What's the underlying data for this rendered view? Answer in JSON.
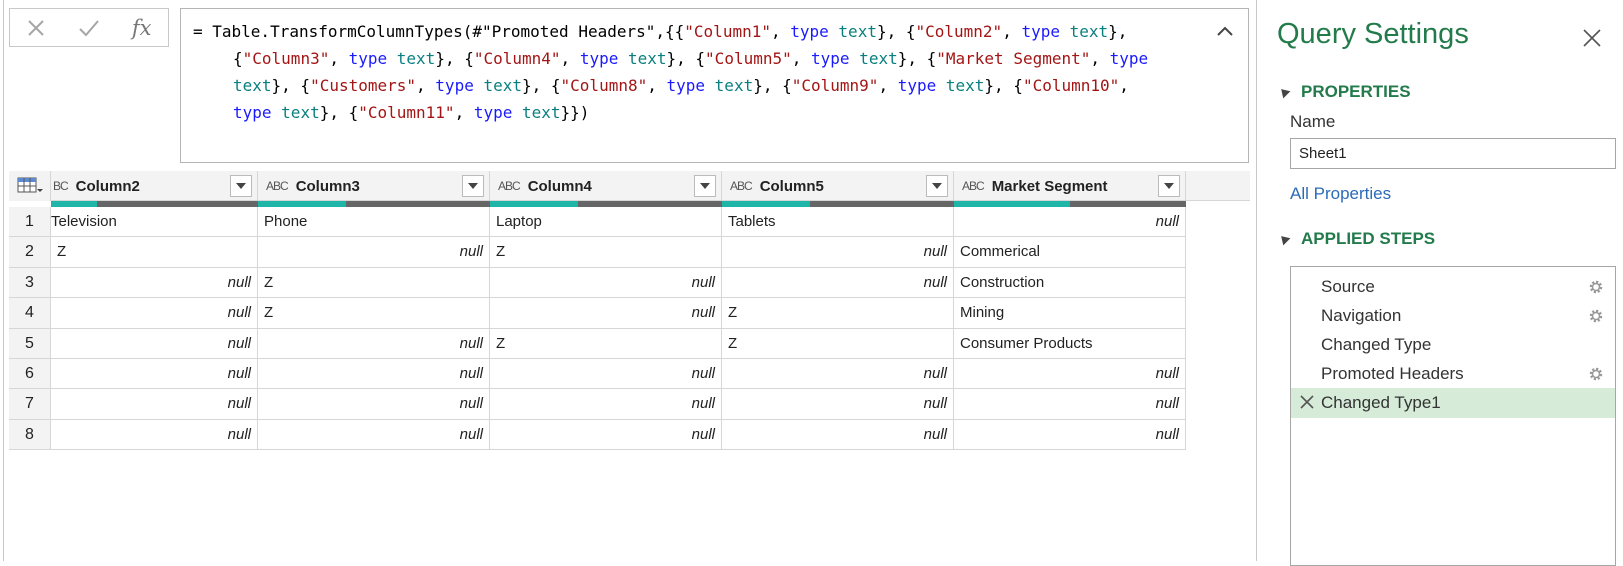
{
  "formula_bar": {
    "cancel_icon": "x-icon",
    "commit_icon": "check-icon",
    "fx_label": "fx",
    "lines": [
      [
        [
          "= Table.TransformColumnTypes(#\"Promoted Headers\",{{",
          ""
        ],
        [
          "\"Column1\"",
          "st"
        ],
        [
          ", ",
          ""
        ],
        [
          "type",
          "kw"
        ],
        [
          " ",
          ""
        ],
        [
          "text",
          "ty"
        ],
        [
          "}, {",
          ""
        ],
        [
          "\"Column2\"",
          "st"
        ],
        [
          ", ",
          ""
        ],
        [
          "type",
          "kw"
        ],
        [
          " ",
          ""
        ],
        [
          "text",
          "ty"
        ],
        [
          "},",
          ""
        ]
      ],
      [
        [
          "{",
          ""
        ],
        [
          "\"Column3\"",
          "st"
        ],
        [
          ", ",
          ""
        ],
        [
          "type",
          "kw"
        ],
        [
          " ",
          ""
        ],
        [
          "text",
          "ty"
        ],
        [
          "}, {",
          ""
        ],
        [
          "\"Column4\"",
          "st"
        ],
        [
          ", ",
          ""
        ],
        [
          "type",
          "kw"
        ],
        [
          " ",
          ""
        ],
        [
          "text",
          "ty"
        ],
        [
          "}, {",
          ""
        ],
        [
          "\"Column5\"",
          "st"
        ],
        [
          ", ",
          ""
        ],
        [
          "type",
          "kw"
        ],
        [
          " ",
          ""
        ],
        [
          "text",
          "ty"
        ],
        [
          "}, {",
          ""
        ],
        [
          "\"Market Segment\"",
          "st"
        ],
        [
          ", ",
          ""
        ],
        [
          "type",
          "kw"
        ]
      ],
      [
        [
          "text",
          "ty"
        ],
        [
          "}, {",
          ""
        ],
        [
          "\"Customers\"",
          "st"
        ],
        [
          ", ",
          ""
        ],
        [
          "type",
          "kw"
        ],
        [
          " ",
          ""
        ],
        [
          "text",
          "ty"
        ],
        [
          "}, {",
          ""
        ],
        [
          "\"Column8\"",
          "st"
        ],
        [
          ", ",
          ""
        ],
        [
          "type",
          "kw"
        ],
        [
          " ",
          ""
        ],
        [
          "text",
          "ty"
        ],
        [
          "}, {",
          ""
        ],
        [
          "\"Column9\"",
          "st"
        ],
        [
          ", ",
          ""
        ],
        [
          "type",
          "kw"
        ],
        [
          " ",
          ""
        ],
        [
          "text",
          "ty"
        ],
        [
          "}, {",
          ""
        ],
        [
          "\"Column10\"",
          "st"
        ],
        [
          ",",
          ""
        ]
      ],
      [
        [
          "type",
          "kw"
        ],
        [
          " ",
          ""
        ],
        [
          "text",
          "ty"
        ],
        [
          "}, {",
          ""
        ],
        [
          "\"Column11\"",
          "st"
        ],
        [
          ", ",
          ""
        ],
        [
          "type",
          "kw"
        ],
        [
          " ",
          ""
        ],
        [
          "text",
          "ty"
        ],
        [
          "}})",
          ""
        ]
      ]
    ]
  },
  "grid": {
    "type_icon": "ABC",
    "first_col_type_icon": "BC",
    "columns": [
      "Column2",
      "Column3",
      "Column4",
      "Column5",
      "Market Segment"
    ],
    "quality_valid": [
      0.22,
      0.38,
      0.38,
      0.38,
      0.5
    ],
    "rows": [
      [
        "Television",
        "Phone",
        "Laptop",
        "Tablets",
        null
      ],
      [
        "Z",
        null,
        "Z",
        null,
        "Commerical"
      ],
      [
        null,
        "Z",
        null,
        null,
        "Construction"
      ],
      [
        null,
        "Z",
        null,
        "Z",
        "Mining"
      ],
      [
        null,
        null,
        "Z",
        "Z",
        "Consumer Products"
      ],
      [
        null,
        null,
        null,
        null,
        null
      ],
      [
        null,
        null,
        null,
        null,
        null
      ],
      [
        null,
        null,
        null,
        null,
        null
      ]
    ],
    "null_text": "null"
  },
  "query_settings": {
    "title": "Query Settings",
    "properties_header": "PROPERTIES",
    "name_label": "Name",
    "name_value": "Sheet1",
    "all_properties_link": "All Properties",
    "applied_steps_header": "APPLIED STEPS",
    "steps": [
      {
        "label": "Source",
        "gear": true,
        "selected": false
      },
      {
        "label": "Navigation",
        "gear": true,
        "selected": false
      },
      {
        "label": "Changed Type",
        "gear": false,
        "selected": false
      },
      {
        "label": "Promoted Headers",
        "gear": true,
        "selected": false
      },
      {
        "label": "Changed Type1",
        "gear": false,
        "selected": true
      }
    ]
  },
  "colors": {
    "accent_green": "#237b4b",
    "link_blue": "#2b6bb8",
    "quality_valid": "#1fb5a8",
    "selected_step": "#d6ecd9"
  }
}
